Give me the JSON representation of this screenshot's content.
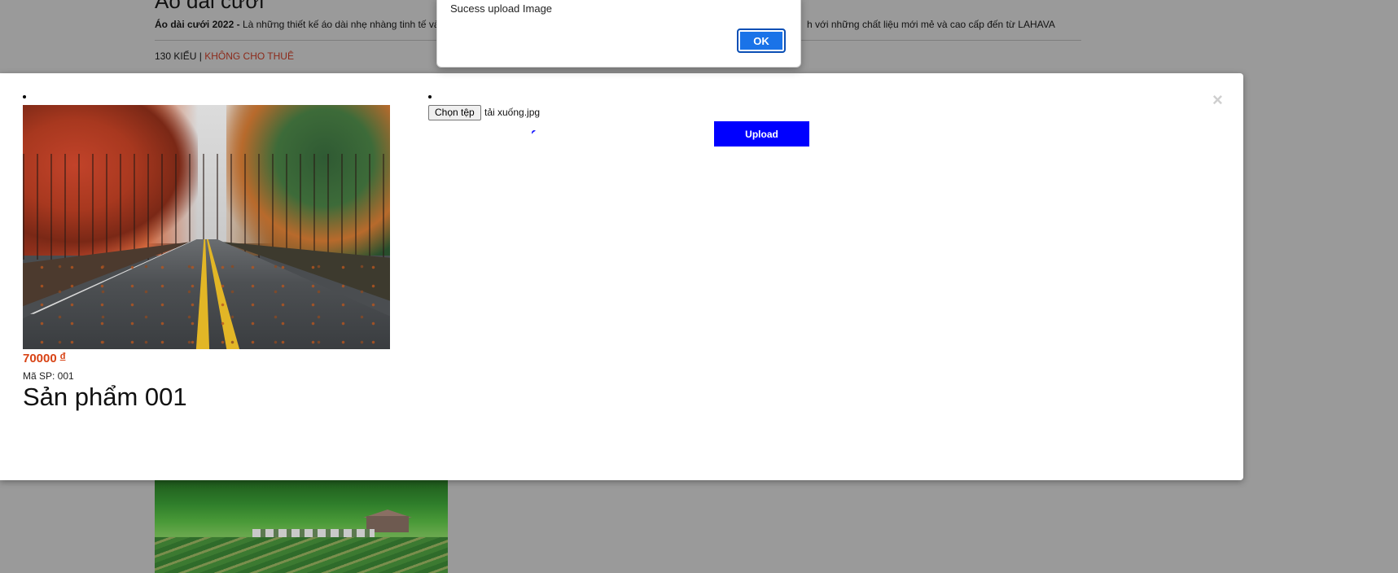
{
  "background_page": {
    "title": "Áo dài cưới",
    "description_bold": "Áo dài cưới 2022 -",
    "description_start": "Là những thiết kế áo dài nhẹ nhàng tinh tế và",
    "description_end": "h với những chất liệu mới mẻ và cao cấp đến từ LAHAVA",
    "style_count": "130 KIỂU",
    "separator": "|",
    "rental_note": "KHÔNG CHO THUÊ"
  },
  "modal": {
    "close_symbol": "×",
    "product": {
      "price": "70000",
      "currency": "đ",
      "sku": "Mã SP: 001",
      "name": "Sản phẩm 001"
    },
    "upload": {
      "choose_file_label": "Chọn tệp",
      "file_name": "tải xuống.jpg",
      "upload_label": "Upload"
    }
  },
  "alert": {
    "message": "Sucess upload Image",
    "ok_label": "OK"
  },
  "colors": {
    "price": "#d84315",
    "upload_button": "#0000ff",
    "ok_button": "#1a73e8",
    "overlay": "#9a9a9a"
  }
}
